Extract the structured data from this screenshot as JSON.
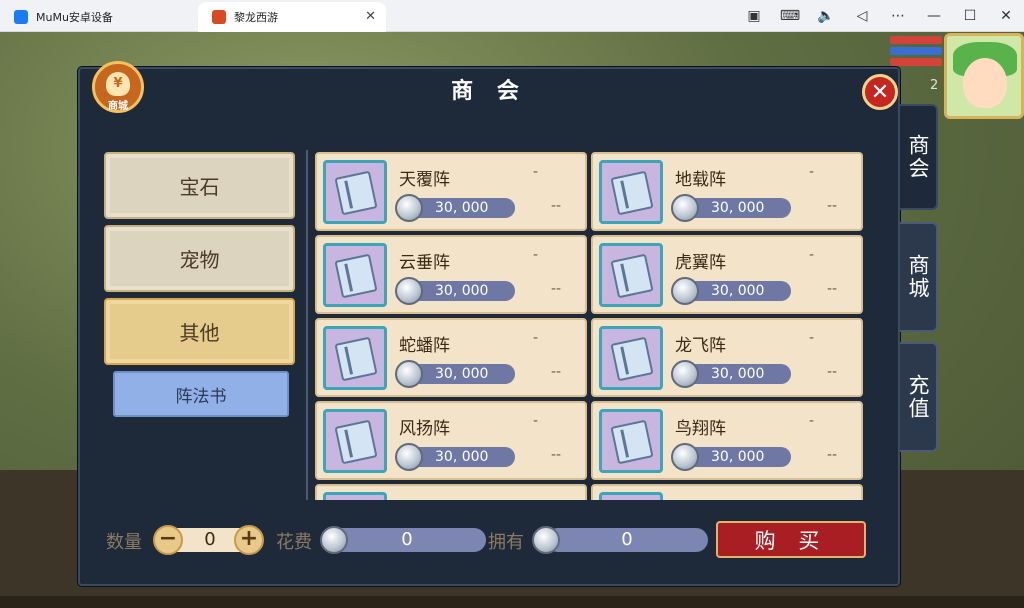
{
  "browser": {
    "tabs": [
      {
        "label": "MuMu安卓设备",
        "icon": "mumu-icon"
      },
      {
        "label": "黎龙西游",
        "icon": "game-icon"
      }
    ],
    "tools": [
      "screenshot-icon",
      "keyboard-icon",
      "volume-icon",
      "back-icon",
      "more-icon",
      "minimize-icon",
      "maximize-icon",
      "close-icon"
    ]
  },
  "hud": {
    "level": "2"
  },
  "panel": {
    "title": "商 会",
    "emblem_label": "商城",
    "emblem_symbol": "¥"
  },
  "side_tabs": [
    "商会",
    "商城",
    "充值"
  ],
  "categories": [
    "宝石",
    "宠物",
    "其他"
  ],
  "subcategory": "阵法书",
  "items": [
    {
      "name": "天覆阵",
      "price": "30, 000",
      "dash": "-",
      "dash2": "--"
    },
    {
      "name": "地载阵",
      "price": "30, 000",
      "dash": "-",
      "dash2": "--"
    },
    {
      "name": "云垂阵",
      "price": "30, 000",
      "dash": "-",
      "dash2": "--"
    },
    {
      "name": "虎翼阵",
      "price": "30, 000",
      "dash": "-",
      "dash2": "--"
    },
    {
      "name": "蛇蟠阵",
      "price": "30, 000",
      "dash": "-",
      "dash2": "--"
    },
    {
      "name": "龙飞阵",
      "price": "30, 000",
      "dash": "-",
      "dash2": "--"
    },
    {
      "name": "风扬阵",
      "price": "30, 000",
      "dash": "-",
      "dash2": "--"
    },
    {
      "name": "鸟翔阵",
      "price": "30, 000",
      "dash": "-",
      "dash2": "--"
    }
  ],
  "bottom": {
    "qty_label": "数量",
    "qty_value": "0",
    "minus": "−",
    "plus": "+",
    "cost_label": "花费",
    "cost_value": "0",
    "own_label": "拥有",
    "own_value": "0",
    "buy_label": "购 买"
  },
  "colors": {
    "panel": "#1e2a3a",
    "card": "#f3e3c8",
    "selected_category": "#e6cc8c",
    "subcategory": "#92b0e8",
    "buy_button": "#a81e22"
  }
}
